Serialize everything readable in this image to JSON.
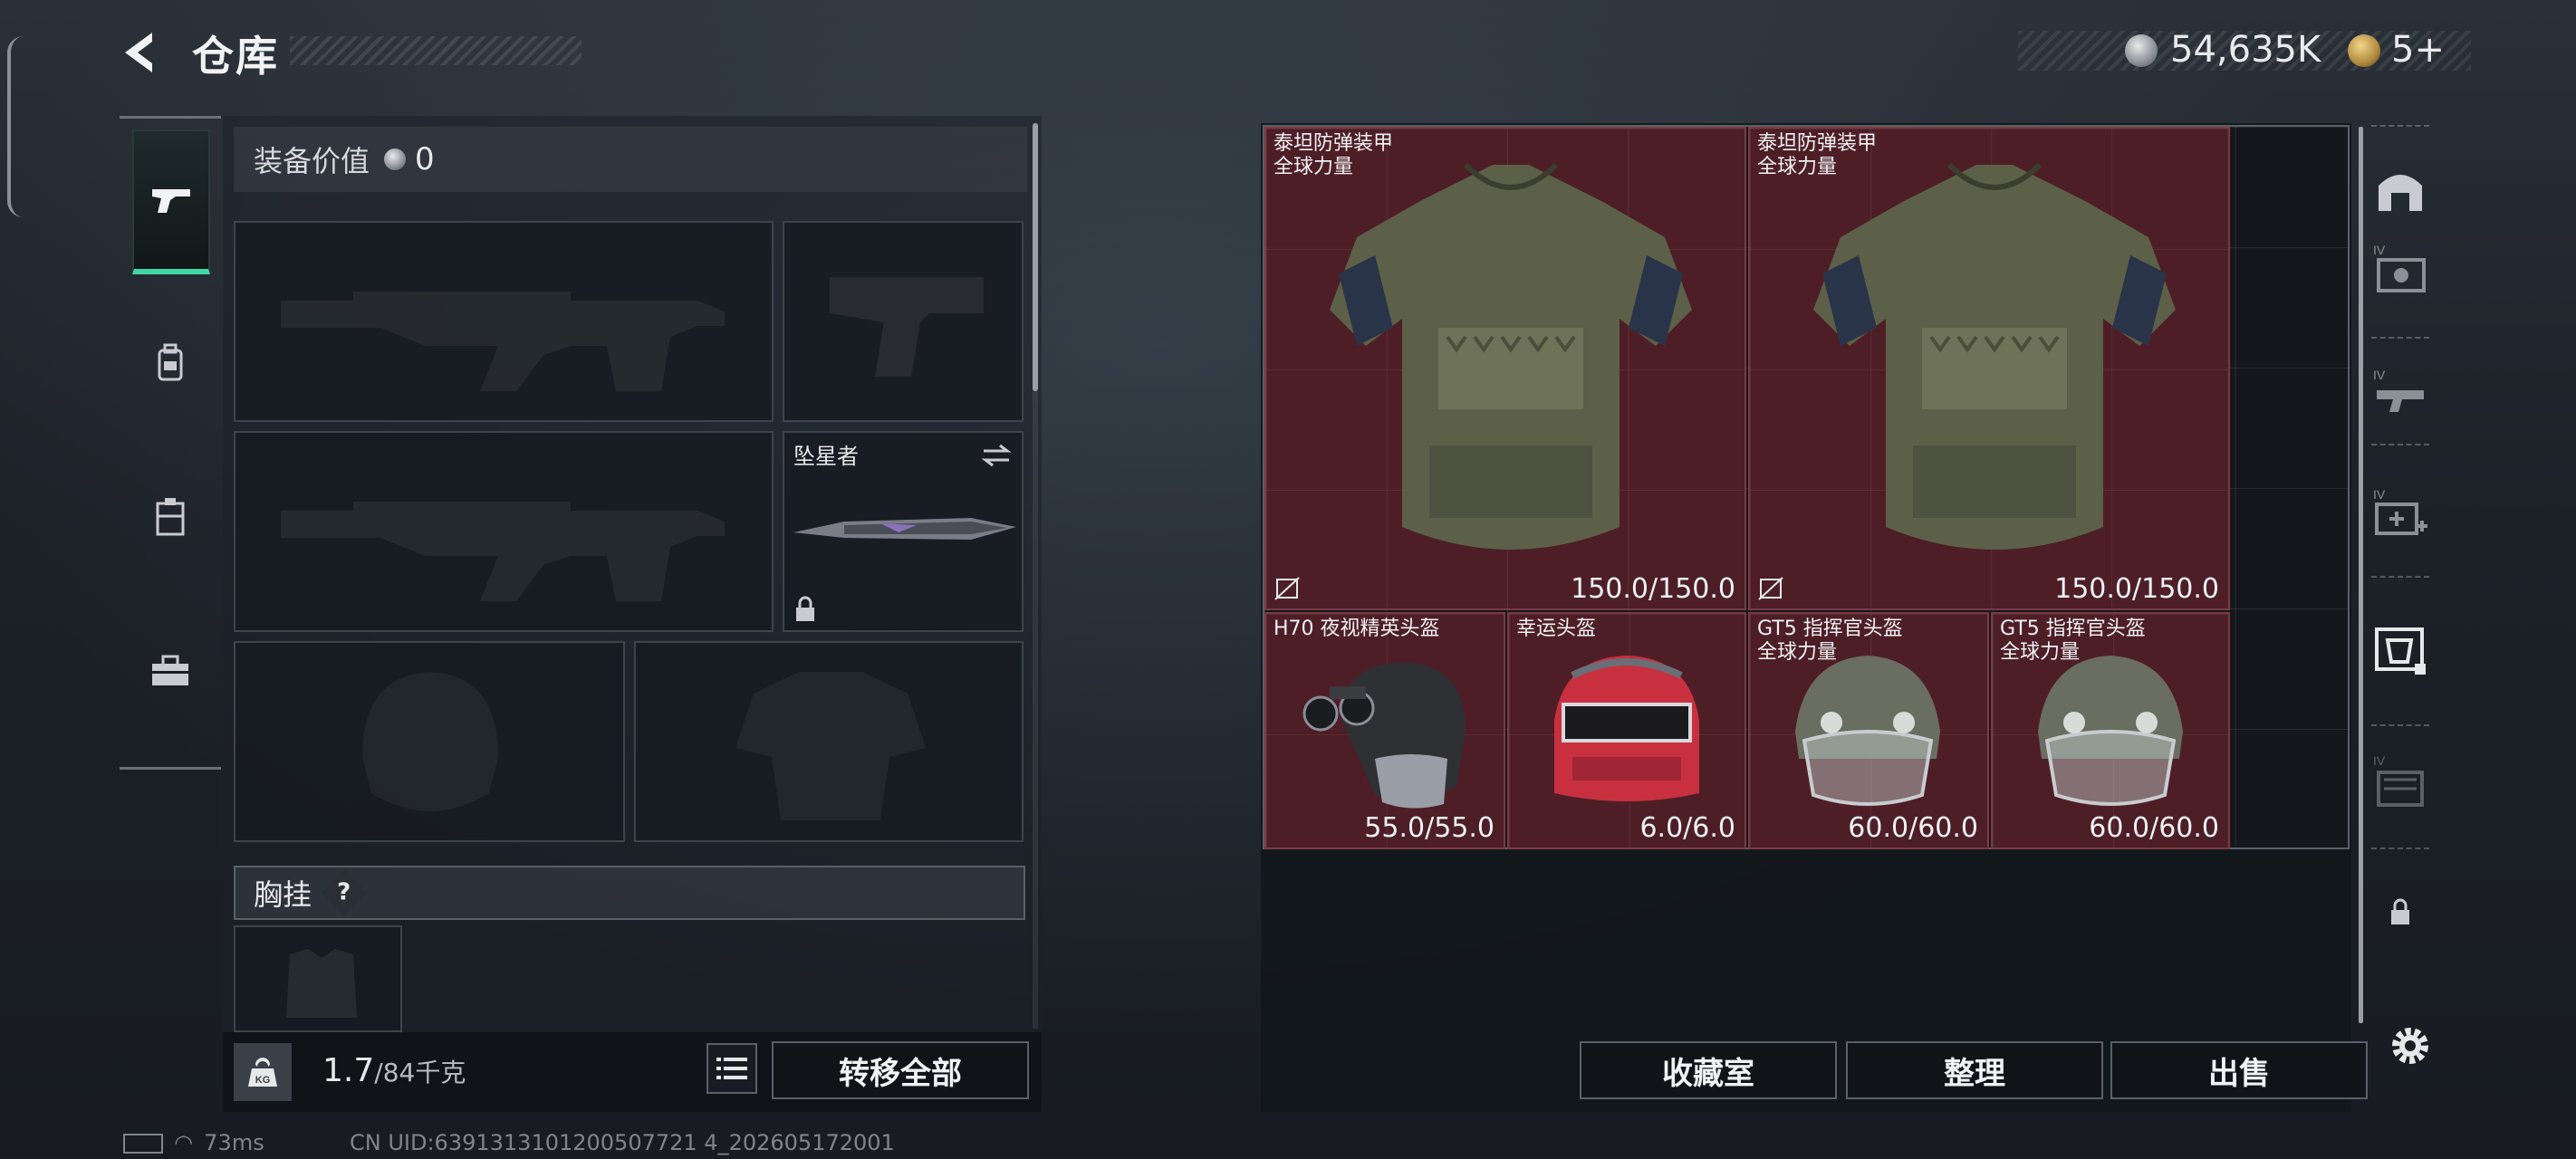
{
  "header": {
    "title": "仓库",
    "currency_silver": "54,635K",
    "currency_gold": "5+"
  },
  "left_nav": {
    "items": [
      {
        "icon": "pistol-icon",
        "active": true
      },
      {
        "icon": "backpack-icon",
        "active": false
      },
      {
        "icon": "container-icon",
        "active": false
      },
      {
        "icon": "toolbox-icon",
        "active": false
      }
    ]
  },
  "loadout": {
    "value_label": "装备价值",
    "value_amount": "0",
    "melee_name": "坠星者",
    "chest_label": "胸挂",
    "help": "?"
  },
  "footer_left": {
    "weight_current": "1.7",
    "weight_max": "/84千克",
    "kg": "KG",
    "transfer_all": "转移全部"
  },
  "stash": {
    "items": [
      {
        "name1": "泰坦防弹装甲",
        "name2": "全球力量",
        "durability": "150.0/150.0"
      },
      {
        "name1": "泰坦防弹装甲",
        "name2": "全球力量",
        "durability": "150.0/150.0"
      },
      {
        "name1": "H70 夜视精英头盔",
        "name2": "",
        "durability": "55.0/55.0"
      },
      {
        "name1": "幸运头盔",
        "name2": "",
        "durability": "6.0/6.0"
      },
      {
        "name1": "GT5 指挥官头盔",
        "name2": "全球力量",
        "durability": "60.0/60.0"
      },
      {
        "name1": "GT5 指挥官头盔",
        "name2": "全球力量",
        "durability": "60.0/60.0"
      }
    ],
    "buttons": {
      "collection": "收藏室",
      "sort": "整理",
      "sell": "出售"
    }
  },
  "right_rail": {
    "labels": [
      "IV",
      "IV",
      "IV",
      "IV"
    ]
  },
  "status_bar": {
    "ping": "73ms",
    "uid": "CN UID:6391313101200507721 4_202605172001"
  },
  "colors": {
    "accent": "#3fd7a6",
    "item_bg": "#5c2028",
    "panel": "#1c2128"
  }
}
